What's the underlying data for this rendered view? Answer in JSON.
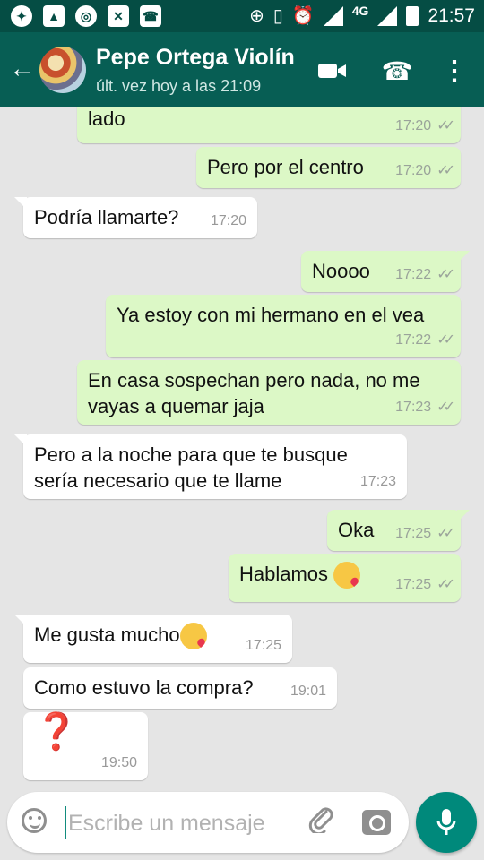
{
  "status_bar": {
    "time": "21:57",
    "network": "4G",
    "left_icons": [
      "messenger-icon",
      "gallery-icon",
      "chrome-icon",
      "settings-icon",
      "phone-badge-icon"
    ],
    "right_icons": [
      "add-icon",
      "vibrate-icon",
      "alarm-icon",
      "signal-icon",
      "signal-icon",
      "battery-icon"
    ]
  },
  "chat_header": {
    "name": "Pepe Ortega Violín",
    "last_seen": "últ. vez hoy a las 21:09"
  },
  "messages": [
    {
      "direction": "out",
      "text": "lado",
      "time": "17:20",
      "status": "read"
    },
    {
      "direction": "out",
      "text": "Pero por el centro",
      "time": "17:20",
      "status": "read"
    },
    {
      "direction": "in",
      "text": "Podría llamarte?",
      "time": "17:20"
    },
    {
      "direction": "out",
      "text": "Noooo",
      "time": "17:22",
      "status": "read"
    },
    {
      "direction": "out",
      "text": "Ya estoy con mi hermano en el vea",
      "time": "17:22",
      "status": "read"
    },
    {
      "direction": "out",
      "text": "En casa sospechan pero nada, no me vayas a quemar jaja",
      "time": "17:23",
      "status": "read"
    },
    {
      "direction": "in",
      "text": "Pero a la noche para que te busque sería necesario que te llame",
      "time": "17:23"
    },
    {
      "direction": "out",
      "text": "Oka",
      "time": "17:25",
      "status": "read"
    },
    {
      "direction": "out",
      "text": "Hablamos",
      "emoji": "kiss-emoji",
      "time": "17:25",
      "status": "read"
    },
    {
      "direction": "in",
      "text": "Me gusta mucho",
      "emoji": "kiss-emoji",
      "time": "17:25"
    },
    {
      "direction": "in",
      "text": "Como estuvo la compra?",
      "time": "19:01"
    },
    {
      "direction": "in",
      "text": "❓",
      "time": "19:50"
    }
  ],
  "composer": {
    "placeholder": "Escribe un mensaje",
    "value": ""
  },
  "ticks_text": "✓✓",
  "colors": {
    "header": "#075e54",
    "status_bar": "#054d44",
    "outgoing": "#dcf8c6",
    "incoming": "#ffffff",
    "chat_background": "#e5e5e5",
    "mic_button": "#00897b"
  }
}
